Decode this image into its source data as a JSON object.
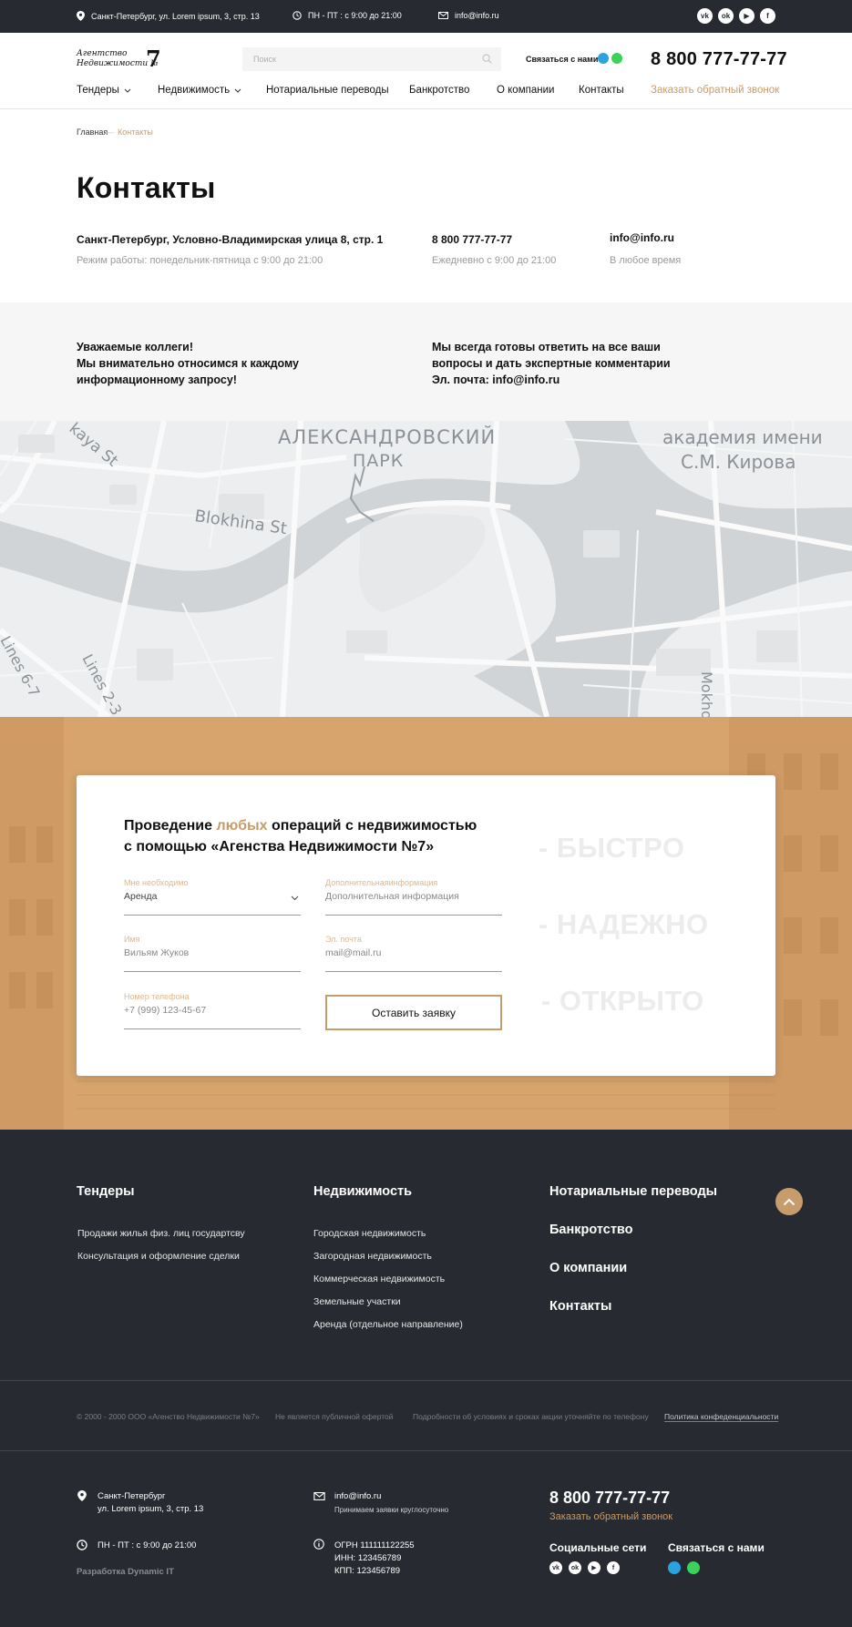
{
  "topbar": {
    "address": "Санкт-Петербург, ул. Lorem ipsum, 3, стр. 13",
    "hours": "ПН - ПТ : с 9:00 до 21:00",
    "email": "info@info.ru",
    "socials": [
      "vk-icon",
      "odnoklassniki-icon",
      "youtube-icon",
      "facebook-icon"
    ]
  },
  "header": {
    "logo_line1": "Агентство",
    "logo_line2": "Недвижимости №",
    "logo_number": "7",
    "search_placeholder": "Поиск",
    "contact_label": "Связаться с нами",
    "phone": "8 800 777-77-77",
    "nav": [
      {
        "label": "Тендеры",
        "dropdown": true
      },
      {
        "label": "Недвижимость",
        "dropdown": true
      },
      {
        "label": "Нотариальные переводы",
        "dropdown": false
      },
      {
        "label": "Банкротство",
        "dropdown": false
      },
      {
        "label": "О компании",
        "dropdown": false
      },
      {
        "label": "Контакты",
        "dropdown": false
      }
    ],
    "callback": "Заказать обратный звонок"
  },
  "breadcrumb": {
    "home": "Главная",
    "current": "Контакты"
  },
  "page": {
    "title": "Контакты",
    "address": "Санкт-Петербург, Условно-Владимирская улица 8, стр. 1",
    "address_hours": "Режим работы: понедельник-пятница с 9:00 до 21:00",
    "phone": "8 800 777-77-77",
    "phone_hours": "Ежедневно с 9:00 до 21:00",
    "email": "info@info.ru",
    "email_hours": "В любое время"
  },
  "band": {
    "left": [
      "Уважаемые коллеги!",
      "Мы внимательно относимся  к каждому",
      "информационному запросу!"
    ],
    "right": [
      "Мы всегда готовы ответить на все ваши",
      "вопросы и дать экспертные комментарии",
      "Эл. почта: info@info.ru"
    ]
  },
  "map": {
    "labels": [
      "АЛЕКСАНДРОВСКИЙ",
      "ПАРК",
      "академия имени",
      "С.М. Кирова",
      "Blokhina St",
      "kaya St",
      "Lines 2-3",
      "Lines 6-7",
      "Mokho"
    ]
  },
  "form": {
    "title_a": "Проведение ",
    "title_accent": "любых",
    "title_b": " операций с недвижимостью",
    "title_c": "с помощью «Агенства Недвижимости №7»",
    "need_label": "Мне необходимо",
    "need_value": "Аренда",
    "extra_label": "Дополнительнаяинформация",
    "extra_placeholder": "Дополнительная информация",
    "name_label": "Имя",
    "name_placeholder": "Вильям Жуков",
    "email_label": "Эл. почта",
    "email_placeholder": "mail@mail.ru",
    "phone_label": "Номер телефона",
    "phone_placeholder": "+7 (999) 123-45-67",
    "submit": "Оставить заявку",
    "slogans": [
      "- БЫСТРО",
      "- НАДЕЖНО",
      "- ОТКРЫТО"
    ]
  },
  "footer": {
    "col1_title": "Тендеры",
    "col1_links": [
      "Продажи жилья физ. лиц государтсву",
      "Консультация и оформление сделки"
    ],
    "col2_title": "Недвижимость",
    "col2_links": [
      "Городская недвижимость",
      "Загородная недвижимость",
      "Коммерческая недвижимость",
      "Земельные участки",
      "Аренда (отдельное направление)"
    ],
    "col3_links": [
      "Нотариальные переводы",
      "Банкротство",
      "О компании",
      "Контакты"
    ],
    "legal": [
      "© 2000 - 2000 ООО «Агенство Недвижимости №7»",
      "Не является публичной офертой",
      "Подробности об условиях и сроках акции уточняйте по телефону",
      "Политика конфеденциальности"
    ],
    "city": "Санкт-Петербург",
    "street": "ул. Lorem ipsum, 3, стр. 13",
    "hours": "ПН - ПТ : с 9:00 до 21:00",
    "developer": "Разработка Dynamic IT",
    "email": "info@info.ru",
    "email_note": "Принимаем заявки круглосуточно",
    "ogrn": "ОГРН 111111122255",
    "inn": "ИНН: 123456789",
    "kpp": "КПП: 123456789",
    "phone": "8 800 777-77-77",
    "callback": "Заказать обратный звонок",
    "socials_title": "Социальные сети",
    "contact_title": "Связаться с нами"
  },
  "colors": {
    "accent": "#C69C6D",
    "dark": "#272A30",
    "telegram": "#2AA3DE",
    "whatsapp": "#3BD25A"
  }
}
